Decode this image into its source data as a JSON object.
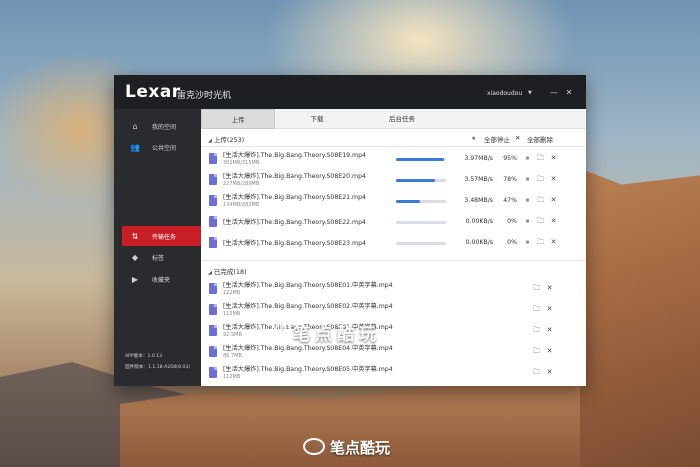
{
  "app": {
    "logo": "Lexar",
    "title": "雷克沙时光机",
    "user": "xiaodoudou"
  },
  "sidebar": {
    "items": [
      {
        "label": "我的空间",
        "icon": "home-icon"
      },
      {
        "label": "公共空间",
        "icon": "users-icon"
      },
      {
        "label": "传输任务",
        "icon": "transfer-icon",
        "active": true
      },
      {
        "label": "标签",
        "icon": "tag-icon"
      },
      {
        "label": "收藏夹",
        "icon": "folder-icon"
      }
    ],
    "app_version": "APP版本：1.0.13",
    "firmware_version": "固件版本：1.1.18-A208(8.03)"
  },
  "tabs": [
    {
      "label": "上传",
      "active": true
    },
    {
      "label": "下载"
    },
    {
      "label": "后台任务"
    }
  ],
  "uploading": {
    "header": "上传(253)",
    "pause_all": "全部停止",
    "delete_all": "全部删除",
    "rows": [
      {
        "name": "[生活大爆炸].The.Big.Bang.Theory.S08E19.mp4",
        "size": "301MB/315MB",
        "speed": "3.97MB/s",
        "percent": "95%",
        "progress": 0.95
      },
      {
        "name": "[生活大爆炸].The.Big.Bang.Theory.S08E20.mp4",
        "size": "227MB/289MB",
        "speed": "3.57MB/s",
        "percent": "78%",
        "progress": 0.78
      },
      {
        "name": "[生活大爆炸].The.Big.Bang.Theory.S08E21.mp4",
        "size": "134MB/282MB",
        "speed": "3.48MB/s",
        "percent": "47%",
        "progress": 0.47
      },
      {
        "name": "[生活大爆炸].The.Big.Bang.Theory.S08E22.mp4",
        "size": "",
        "speed": "0.00KB/s",
        "percent": "0%",
        "progress": 0
      },
      {
        "name": "[生活大爆炸].The.Big.Bang.Theory.S08E23.mp4",
        "size": "",
        "speed": "0.00KB/s",
        "percent": "0%",
        "progress": 0
      }
    ]
  },
  "completed": {
    "header": "已完成(18)",
    "rows": [
      {
        "name": "[生活大爆炸].The.Big.Bang.Theory.S08E01.中英字幕.mp4",
        "size": "122MB"
      },
      {
        "name": "[生活大爆炸].The.Big.Bang.Theory.S08E02.中英字幕.mp4",
        "size": "115MB"
      },
      {
        "name": "[生活大爆炸].The.Big.Bang.Theory.S08E03.中英字幕.mp4",
        "size": "92.5MB"
      },
      {
        "name": "[生活大爆炸].The.Big.Bang.Theory.S08E04.中英字幕.mp4",
        "size": "86.7MB"
      },
      {
        "name": "[生活大爆炸].The.Big.Bang.Theory.S08E05.中英字幕.mp4",
        "size": "112MB"
      }
    ]
  },
  "watermark": "笔点酷玩",
  "footer_brand": "笔点酷玩",
  "colors": {
    "accent": "#c81f26",
    "progress": "#3a7bd5",
    "file_icon": "#6d6fd8"
  }
}
